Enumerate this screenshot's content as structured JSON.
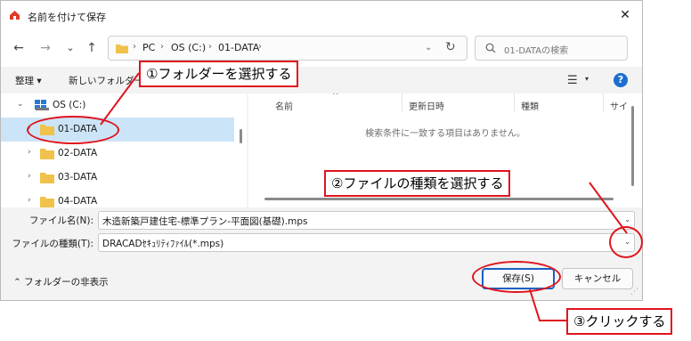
{
  "window": {
    "title": "名前を付けて保存",
    "close_glyph": "✕"
  },
  "nav": {
    "back": "←",
    "forward": "→",
    "up_chevron": "⌄",
    "up": "↑",
    "breadcrumb": [
      "PC",
      "OS (C:)",
      "01-DATA"
    ],
    "separator": "›",
    "dropdown_glyph": "⌄",
    "refresh_glyph": "↻",
    "search_placeholder": "01-DATAの検索"
  },
  "toolbar": {
    "organize": "整理 ▾",
    "new_folder": "新しいフォルダー",
    "view_glyph": "☰",
    "view_chev": "▾",
    "help": "?"
  },
  "sidebar": {
    "drive": {
      "label": "OS (C:)",
      "chev": "⌄"
    },
    "folders": [
      {
        "label": "01-DATA",
        "chev": "›",
        "selected": true
      },
      {
        "label": "02-DATA",
        "chev": "›",
        "selected": false
      },
      {
        "label": "03-DATA",
        "chev": "›",
        "selected": false
      },
      {
        "label": "04-DATA",
        "chev": "›",
        "selected": false
      }
    ]
  },
  "filelist": {
    "columns": [
      "名前",
      "更新日時",
      "種類",
      "サイ"
    ],
    "sort_glyph": "^",
    "empty_message": "検索条件に一致する項目はありません。"
  },
  "fields": {
    "filename_label": "ファイル名(N):",
    "filename_value": "木造新築戸建住宅-標準プラン-平面図(基礎).mps",
    "filetype_label": "ファイルの種類(T):",
    "filetype_value": "DRACADｾｷｭﾘﾃｨﾌｧｲﾙ(*.mps)",
    "chev": "⌄"
  },
  "footer": {
    "hide_folders": "⌃  フォルダーの非表示",
    "save": "保存(S)",
    "cancel": "キャンセル",
    "grip": "⋰"
  },
  "annotations": {
    "step1": "①フォルダーを選択する",
    "step2": "②ファイルの種類を選択する",
    "step3": "③クリックする",
    "color": "#e0141e"
  }
}
